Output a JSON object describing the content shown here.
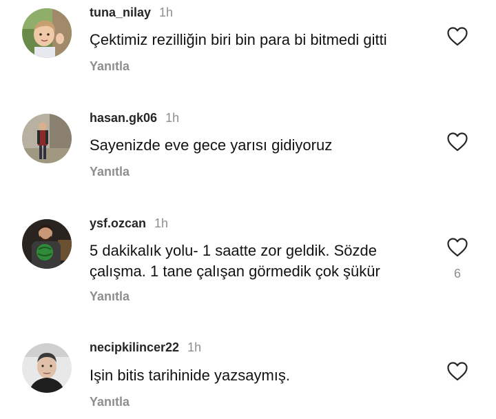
{
  "comments": [
    {
      "username": "tuna_nilay",
      "time": "1h",
      "text": "Çektimiz rezilliğin biri bin para bi bitmedi gitti",
      "reply_label": "Yanıtla",
      "like_icon": "heart-outline-icon",
      "avatar": "child-photo-avatar"
    },
    {
      "username": "hasan.gk06",
      "time": "1h",
      "text": "Sayenizde eve gece yarısı gidiyoruz",
      "reply_label": "Yanıtla",
      "like_icon": "heart-outline-icon",
      "avatar": "man-standing-avatar"
    },
    {
      "username": "ysf.ozcan",
      "time": "1h",
      "text": "5 dakikalık yolu- 1 saatte zor geldik. Sözde çalışma. 1 tane çalışan görmedik çok şükür",
      "reply_label": "Yanıtla",
      "like_icon": "heart-outline-icon",
      "like_count": "6",
      "avatar": "man-with-watermelon-avatar"
    },
    {
      "username": "necipkilincer22",
      "time": "1h",
      "text": "Işin bitis tarihinide yazsaymış.",
      "reply_label": "Yanıtla",
      "like_icon": "heart-outline-icon",
      "avatar": "man-selfie-avatar"
    }
  ],
  "colors": {
    "primary_text": "#121212",
    "username": "#262626",
    "secondary_text": "#8e8e8e",
    "background": "#ffffff"
  }
}
